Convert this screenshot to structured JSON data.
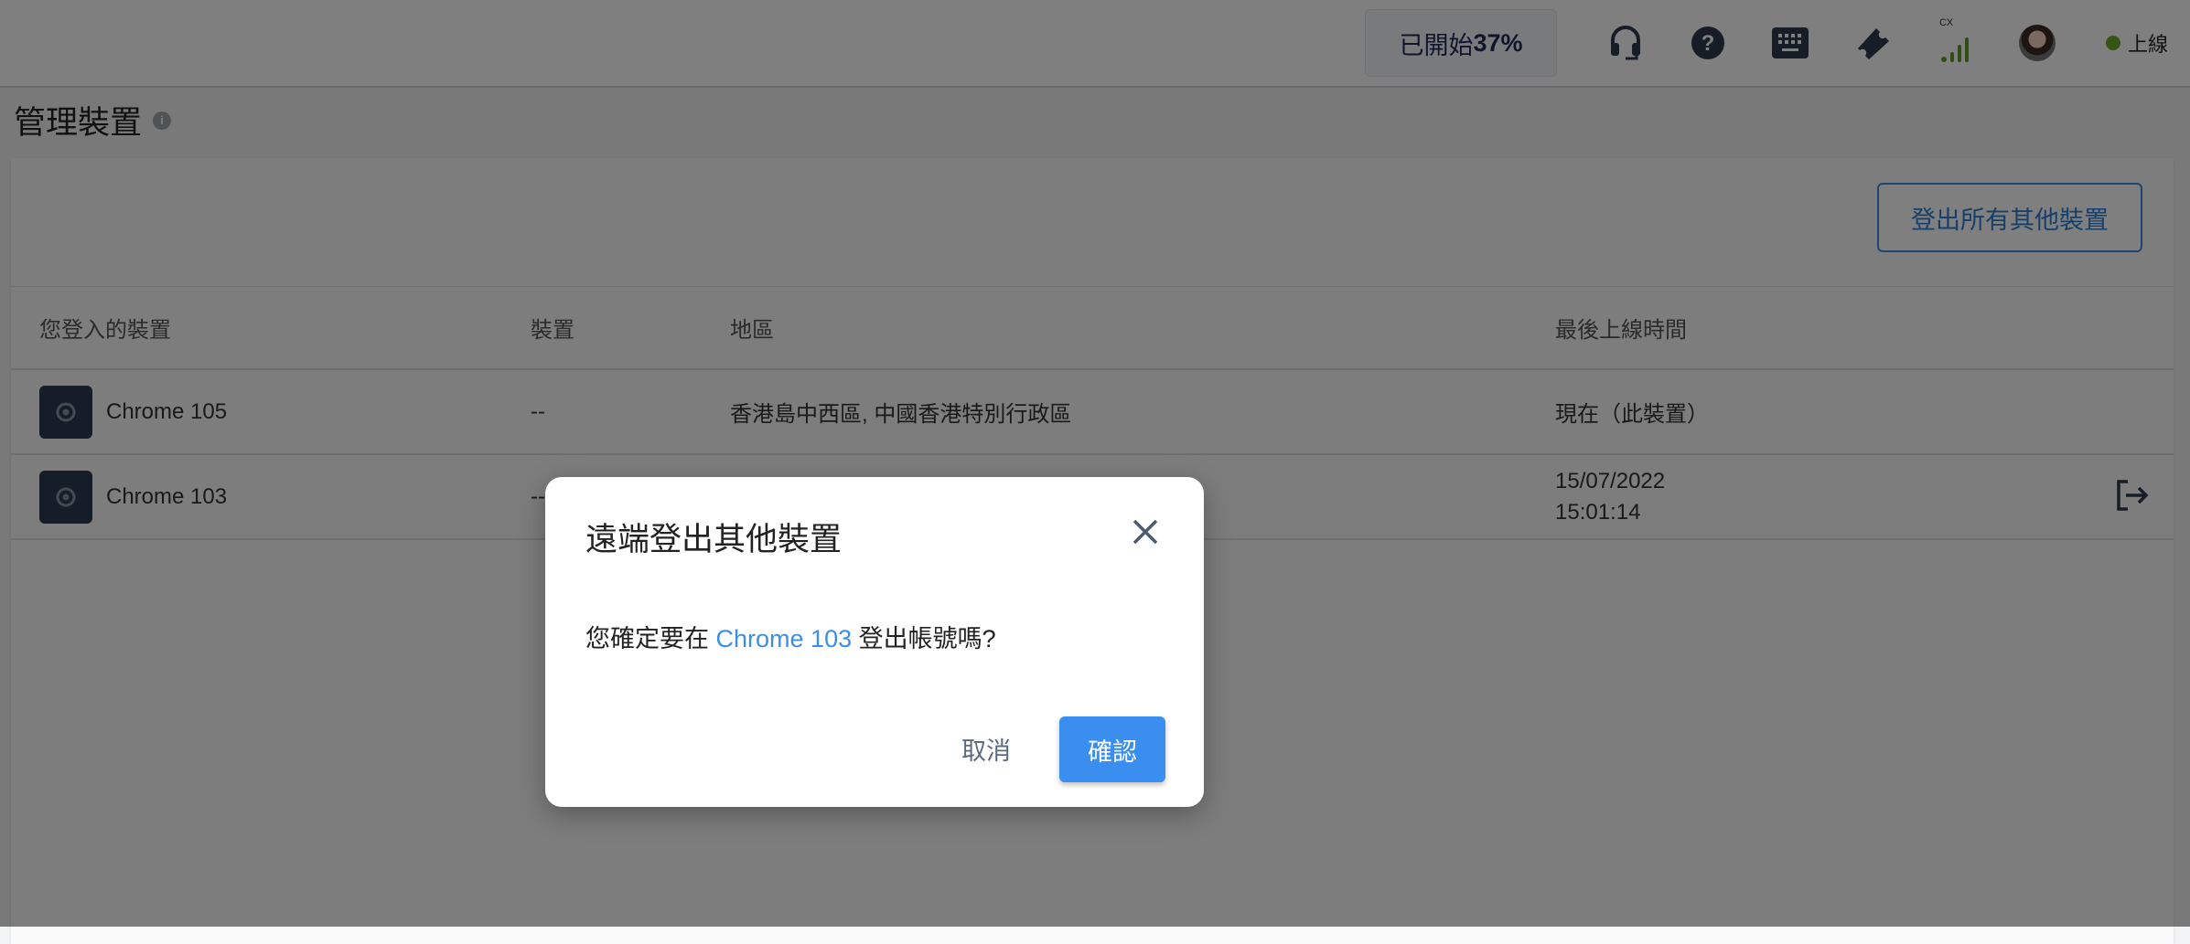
{
  "topbar": {
    "progress_prefix": "已開始",
    "progress_value": "37%",
    "signal_label": "CX",
    "status_label": "上線",
    "status_color": "#6aaa2a",
    "icons": [
      "headset-icon",
      "help-icon",
      "keyboard-icon",
      "ticket-icon",
      "signal-icon",
      "avatar"
    ]
  },
  "page": {
    "title": "管理裝置",
    "info_icon": "i"
  },
  "card": {
    "logout_all_label": "登出所有其他裝置",
    "columns": [
      "您登入的裝置",
      "裝置",
      "地區",
      "最後上線時間"
    ],
    "rows": [
      {
        "name": "Chrome 105",
        "device": "--",
        "region": "香港島中西區, 中國香港特別行政區",
        "last_date": "現在（此裝置）",
        "last_time": ""
      },
      {
        "name": "Chrome 103",
        "device": "--",
        "region": "",
        "last_date": "15/07/2022",
        "last_time": "15:01:14"
      }
    ]
  },
  "dialog": {
    "title": "遠端登出其他裝置",
    "body_prefix": "您確定要在 ",
    "body_device": "Chrome 103",
    "body_suffix": " 登出帳號嗎?",
    "cancel_label": "取消",
    "confirm_label": "確認",
    "accent": "#3a8ef0"
  }
}
